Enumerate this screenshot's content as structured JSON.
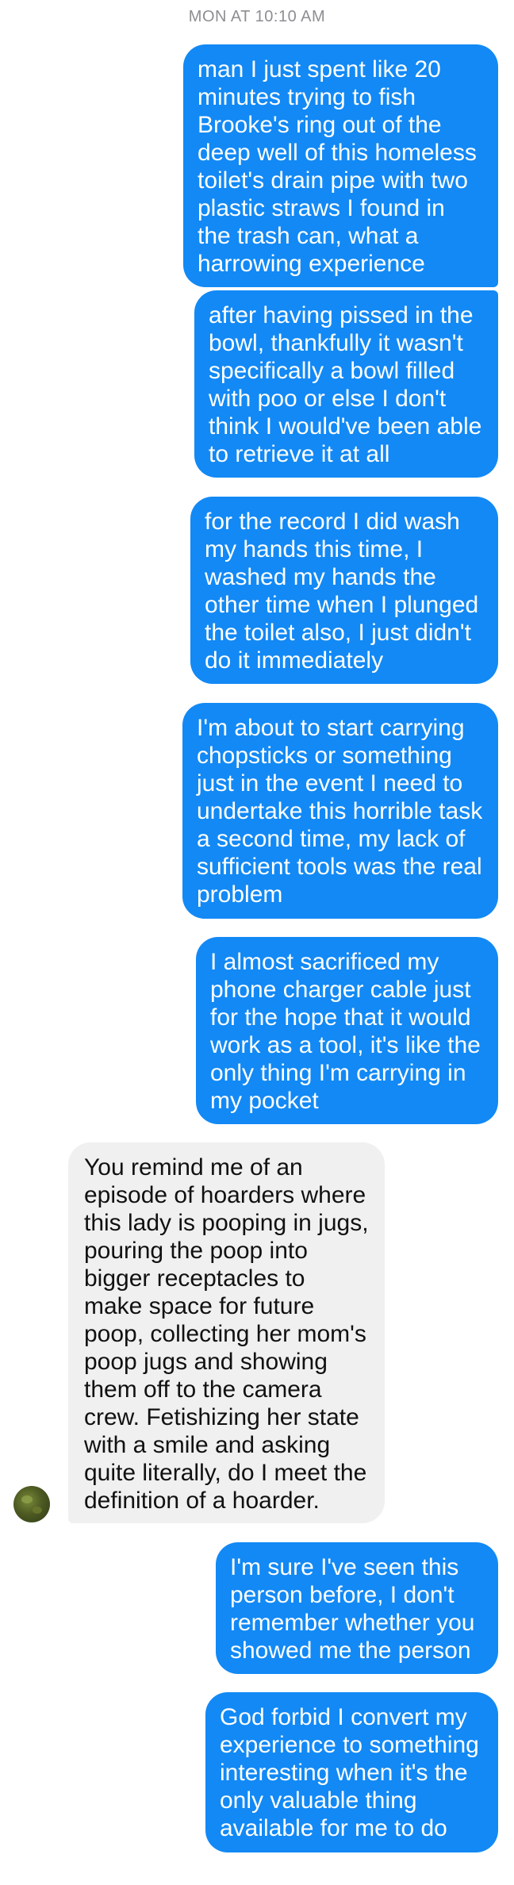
{
  "timestamp": "MON AT 10:10 AM",
  "colors": {
    "outgoing_bubble": "#1289f5",
    "incoming_bubble": "#f0f0f0",
    "timestamp_text": "#8e8e93"
  },
  "messages": [
    {
      "direction": "outgoing",
      "text": "man I just spent like 20 minutes trying to fish Brooke's ring out of the deep well of this homeless toilet's drain pipe with two plastic straws I found in the trash can, what a harrowing experience"
    },
    {
      "direction": "outgoing",
      "text": "after having pissed in the bowl, thankfully it wasn't specifically a bowl filled with poo or else I don't think I would've been able to retrieve it at all"
    },
    {
      "direction": "outgoing",
      "text": "for the record I did wash my hands this time, I washed my hands the other time when I plunged the toilet also, I just didn't do it immediately"
    },
    {
      "direction": "outgoing",
      "text": "I'm about to start carrying chopsticks or something just in the event I need to undertake this horrible task a second time, my lack of sufficient tools was the real problem"
    },
    {
      "direction": "outgoing",
      "text": "I almost sacrificed my phone charger cable just for the hope that it would work as a tool, it's like the only thing I'm carrying in my pocket"
    },
    {
      "direction": "incoming",
      "text": "You remind me of an episode of hoarders where this lady is pooping in jugs, pouring the poop into bigger receptacles to make space for future poop, collecting her mom's poop jugs and showing them off to the camera crew. Fetishizing her state with a smile and asking quite literally, do I meet the definition of a hoarder."
    },
    {
      "direction": "outgoing",
      "text": "I'm sure I've seen this person before, I don't remember whether you showed me the person"
    },
    {
      "direction": "outgoing",
      "text": "God forbid I convert my experience to something interesting when it's the only valuable thing available for me to do"
    }
  ]
}
